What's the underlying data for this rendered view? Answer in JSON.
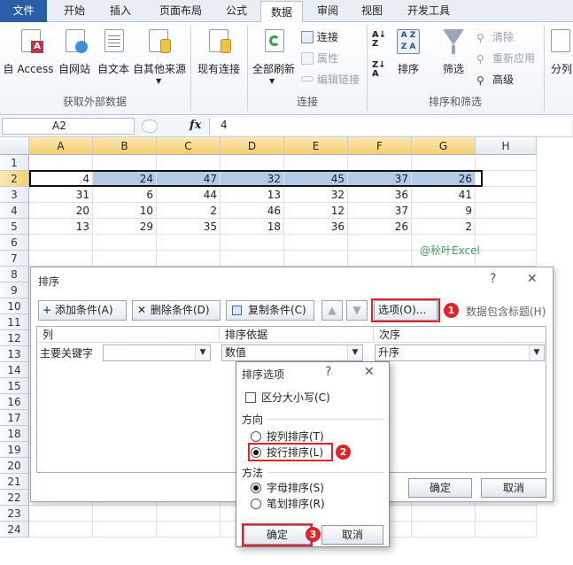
{
  "ribbon": {
    "tabs": [
      "文件",
      "开始",
      "插入",
      "页面布局",
      "公式",
      "数据",
      "审阅",
      "视图",
      "开发工具"
    ],
    "active_tab": "数据",
    "external_data": {
      "access": "自 Access",
      "web": "自网站",
      "text": "自文本",
      "other": "自其他来源",
      "existing": "现有连接",
      "label": "获取外部数据"
    },
    "connections": {
      "refresh_all": "全部刷新",
      "connections": "连接",
      "properties": "属性",
      "edit_links": "编辑链接",
      "label": "连接"
    },
    "sort_filter": {
      "sort": "排序",
      "filter": "筛选",
      "clear": "清除",
      "reapply": "重新应用",
      "advanced": "高级",
      "label": "排序和筛选"
    },
    "data_tools": {
      "split": "分列"
    }
  },
  "formula_bar": {
    "name_box": "A2",
    "fx": "fx",
    "value": "4"
  },
  "grid": {
    "columns": [
      "A",
      "B",
      "C",
      "D",
      "E",
      "F",
      "G",
      "H"
    ],
    "rows": [
      "1",
      "2",
      "3",
      "4",
      "5",
      "6",
      "7",
      "8",
      "9",
      "10",
      "11",
      "12",
      "13",
      "14",
      "15",
      "16",
      "17",
      "18",
      "19",
      "20",
      "21",
      "22",
      "23",
      "24"
    ],
    "data": [
      [
        "4",
        "24",
        "47",
        "32",
        "45",
        "37",
        "26"
      ],
      [
        "31",
        "6",
        "44",
        "13",
        "32",
        "36",
        "41"
      ],
      [
        "20",
        "10",
        "2",
        "46",
        "12",
        "37",
        "9"
      ],
      [
        "13",
        "29",
        "35",
        "18",
        "36",
        "26",
        "2"
      ]
    ],
    "watermark": "@秋叶Excel"
  },
  "sort_dialog": {
    "title": "排序",
    "help": "?",
    "close": "✕",
    "add_level": "添加条件(A)",
    "delete_level": "删除条件(D)",
    "copy_level": "复制条件(C)",
    "options": "选项(O)...",
    "header_check": "数据包含标题(H)",
    "col_header": "列",
    "sorton_header": "排序依据",
    "order_header": "次序",
    "row_label": "主要关键字",
    "key_value": "",
    "sort_on_value": "数值",
    "order_value": "升序",
    "ok": "确定",
    "cancel": "取消",
    "badge1": "1"
  },
  "options_dialog": {
    "title": "排序选项",
    "help": "?",
    "close": "✕",
    "case_sensitive": "区分大小写(C)",
    "orientation_label": "方向",
    "top_to_bottom": "按列排序(T)",
    "left_to_right": "按行排序(L)",
    "method_label": "方法",
    "letter": "字母排序(S)",
    "stroke": "笔划排序(R)",
    "ok": "确定",
    "cancel": "取消",
    "badge2": "2",
    "badge3": "3"
  }
}
